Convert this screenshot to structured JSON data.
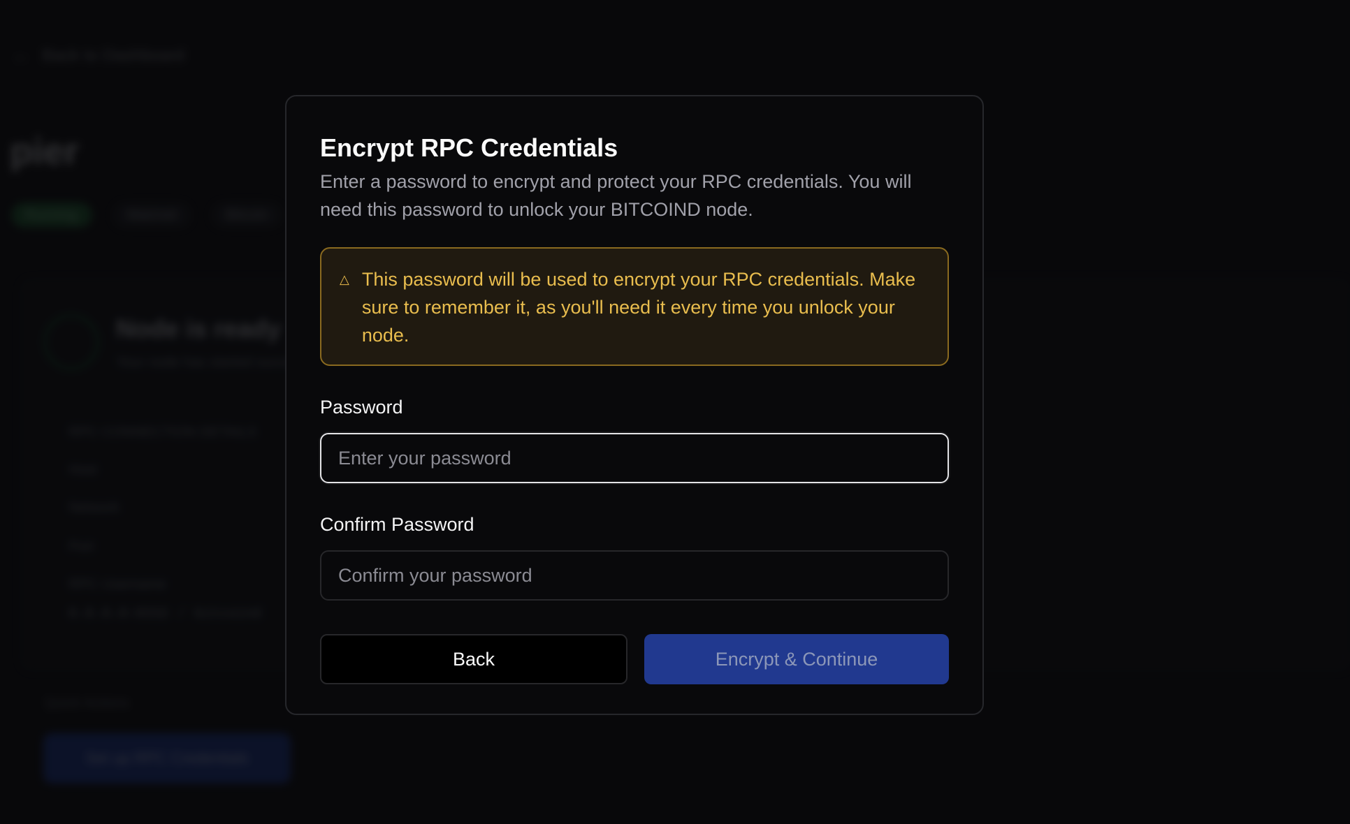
{
  "background": {
    "back_label": "Back to Dashboard",
    "page_title": "pier",
    "badges": [
      "Running",
      "Mainnet",
      "Bitcoin"
    ],
    "card_heading": "Node is ready",
    "card_sub": "Your node has started successfully",
    "rows": [
      "RPC CONNECTION DETAILS",
      "Host",
      "Network",
      "Port",
      "RPC Username"
    ],
    "code_line": "0.0.0.0:8332 / bitcoind",
    "footer_label": "Quick Actions",
    "footer_button": "Set up RPC Credentials"
  },
  "modal": {
    "title": "Encrypt RPC Credentials",
    "description": "Enter a password to encrypt and protect your RPC credentials. You will need this password to unlock your BITCOIND node.",
    "alert": {
      "icon": "warning-triangle-icon",
      "text": "This password will be used to encrypt your RPC credentials. Make sure to remember it, as you'll need it every time you unlock your node.",
      "color": "#e9bd4e"
    },
    "password": {
      "label": "Password",
      "placeholder": "Enter your password",
      "value": ""
    },
    "confirm": {
      "label": "Confirm Password",
      "placeholder": "Confirm your password",
      "value": ""
    },
    "back_button": "Back",
    "submit_button": "Encrypt & Continue",
    "submit_color": "#21398f"
  }
}
